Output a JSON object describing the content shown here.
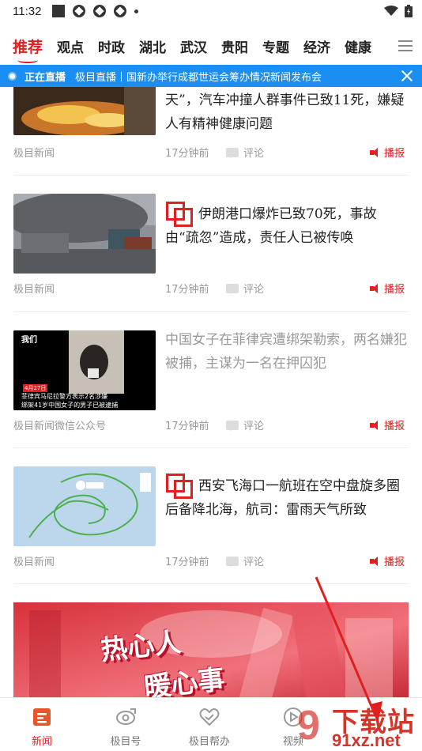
{
  "status_bar": {
    "time": "11:32"
  },
  "tabs": [
    {
      "label": "推荐",
      "active": true
    },
    {
      "label": "观点"
    },
    {
      "label": "时政"
    },
    {
      "label": "湖北"
    },
    {
      "label": "武汉"
    },
    {
      "label": "贵阳"
    },
    {
      "label": "专题"
    },
    {
      "label": "经济"
    },
    {
      "label": "健康"
    }
  ],
  "live_banner": {
    "label": "正在直播",
    "text": "极目直播丨国新办举行成都世运会筹办情况新闻发布会"
  },
  "feed": [
    {
      "title": "天”，汽车冲撞人群事件已致11死，嫌疑人有精神健康问题",
      "source": "极目新闻",
      "time_ago": "17分钟前",
      "comment_label": "评论",
      "broadcast_label": "播报"
    },
    {
      "title": "伊朗港口爆炸已致70死，事故由“疏忽”造成，责任人已被传唤",
      "source": "极目新闻",
      "time_ago": "17分钟前",
      "comment_label": "评论",
      "broadcast_label": "播报"
    },
    {
      "title": "中国女子在菲律宾遭绑架勒索，两名嫌犯被捕，主谋为一名在押囚犯",
      "source": "极目新闻微信公众号",
      "time_ago": "17分钟前",
      "comment_label": "评论",
      "broadcast_label": "播报",
      "thumb_caption_tag": "我们",
      "thumb_caption_date": "4月27日",
      "thumb_caption_line1": "菲律宾马尼拉警方表示2名涉嫌",
      "thumb_caption_line2": "绑架41岁中国女子的男子已被逮捕"
    },
    {
      "title": "西安飞海口一航班在空中盘旋多圈后备降北海，航司：雷雨天气所致",
      "source": "极目新闻",
      "time_ago": "17分钟前",
      "comment_label": "评论",
      "broadcast_label": "播报"
    }
  ],
  "promo_banner": {
    "line1": "热心人",
    "line2": "暖心事"
  },
  "bottom_nav": [
    {
      "label": "新闻",
      "active": true
    },
    {
      "label": "极目号"
    },
    {
      "label": "极目帮办"
    },
    {
      "label": "视频"
    }
  ],
  "watermark": {
    "text": "下载站",
    "url": "91xz.net"
  },
  "colors": {
    "accent": "#e02020",
    "live_bg": "#1a8ef2"
  }
}
